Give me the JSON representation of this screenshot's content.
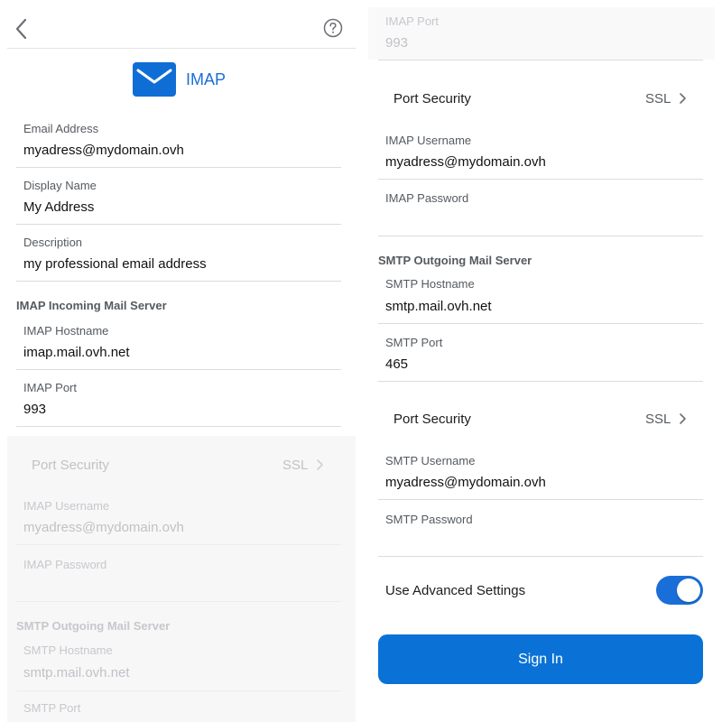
{
  "header": {
    "back_icon": "chevron-left-icon",
    "help_icon": "question-circle-icon",
    "title": "IMAP",
    "logo_icon": "mail-envelope-icon",
    "accent": "#1a6ed8"
  },
  "account": {
    "email_label": "Email Address",
    "email_value": "myadress@mydomain.ovh",
    "display_name_label": "Display Name",
    "display_name_value": "My Address",
    "description_label": "Description",
    "description_value": "my professional email address"
  },
  "imap": {
    "section_title": "IMAP Incoming Mail Server",
    "hostname_label": "IMAP Hostname",
    "hostname_value": "imap.mail.ovh.net",
    "port_label": "IMAP Port",
    "port_value": "993",
    "security_label": "Port Security",
    "security_value": "SSL",
    "username_label": "IMAP Username",
    "username_value": "myadress@mydomain.ovh",
    "password_label": "IMAP Password"
  },
  "smtp": {
    "section_title": "SMTP Outgoing Mail Server",
    "hostname_label": "SMTP Hostname",
    "hostname_value": "smtp.mail.ovh.net",
    "port_label": "SMTP Port",
    "port_value": "465",
    "security_label": "Port Security",
    "security_value": "SSL",
    "username_label": "SMTP Username",
    "username_value": "myadress@mydomain.ovh",
    "password_label": "SMTP Password"
  },
  "advanced": {
    "label": "Use Advanced Settings",
    "enabled": true
  },
  "signin": {
    "label": "Sign In",
    "color": "#0a72d6"
  }
}
